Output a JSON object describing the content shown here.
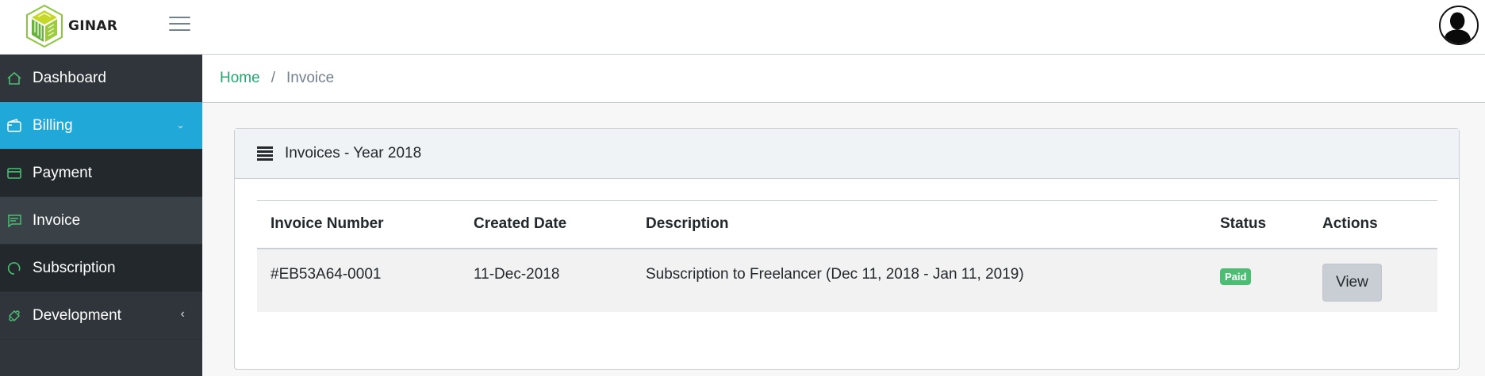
{
  "header": {
    "brand": "GINAR"
  },
  "sidebar": {
    "items": [
      {
        "label": "Dashboard",
        "icon": "home-icon"
      },
      {
        "label": "Billing",
        "icon": "wallet-icon",
        "state": "active"
      },
      {
        "label": "Payment",
        "icon": "credit-card-icon"
      },
      {
        "label": "Invoice",
        "icon": "message-icon",
        "state": "selected"
      },
      {
        "label": "Subscription",
        "icon": "circle-icon"
      },
      {
        "label": "Development",
        "icon": "puzzle-icon"
      }
    ]
  },
  "breadcrumb": {
    "home": "Home",
    "separator": "/",
    "current": "Invoice"
  },
  "card": {
    "title": "Invoices - Year 2018"
  },
  "table": {
    "columns": [
      "Invoice Number",
      "Created Date",
      "Description",
      "Status",
      "Actions"
    ],
    "rows": [
      {
        "invoice_number": "#EB53A64-0001",
        "created_date": "11-Dec-2018",
        "description": "Subscription to Freelancer (Dec 11, 2018 - Jan 11, 2019)",
        "status": "Paid",
        "action": "View"
      }
    ]
  },
  "colors": {
    "accent": "#20a8d8",
    "link": "#27a66f",
    "success": "#4dbd74",
    "sidebar_bg": "#2f353a"
  }
}
